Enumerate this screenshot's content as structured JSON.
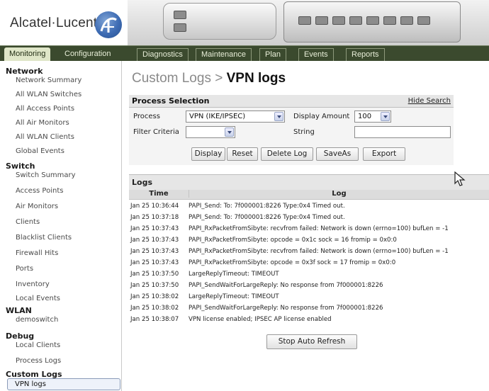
{
  "brand": {
    "name": "Alcatel·Lucent"
  },
  "nav": {
    "tabs": [
      "Monitoring",
      "Configuration",
      "Diagnostics",
      "Maintenance",
      "Plan",
      "Events",
      "Reports"
    ],
    "active": "Monitoring"
  },
  "sidebar": {
    "groups": [
      {
        "title": "Network",
        "items": [
          "Network Summary",
          "All WLAN Switches",
          "All Access Points",
          "All Air Monitors",
          "All WLAN Clients",
          "Global Events"
        ]
      },
      {
        "title": "Switch",
        "items": [
          "Switch Summary",
          "Access Points",
          "Air Monitors",
          "Clients",
          "Blacklist Clients",
          "Firewall Hits",
          "Ports",
          "Inventory",
          "Local Events"
        ]
      },
      {
        "title": "WLAN",
        "items": [
          "demoswitch"
        ]
      },
      {
        "title": "Debug",
        "items": [
          "Local Clients",
          "Process Logs"
        ]
      },
      {
        "title": "Custom Logs",
        "items": [
          "VPN logs"
        ]
      }
    ],
    "selected": "VPN logs"
  },
  "page": {
    "title_prefix": "Custom Logs >",
    "title_main": "VPN logs"
  },
  "process_selection": {
    "title": "Process Selection",
    "hide_link": "Hide Search",
    "process_label": "Process",
    "process_value": "VPN (IKE/IPSEC)",
    "display_amount_label": "Display Amount",
    "display_amount_value": "100",
    "filter_label": "Filter Criteria",
    "filter_value": "",
    "string_label": "String",
    "string_value": "",
    "buttons": {
      "display": "Display",
      "reset": "Reset",
      "delete": "Delete Log",
      "saveas": "SaveAs",
      "export": "Export"
    }
  },
  "logs": {
    "title": "Logs",
    "col_time": "Time",
    "col_log": "Log",
    "rows": [
      {
        "time": "Jan 25 10:36:44",
        "log": "PAPI_Send: To: 7f000001:8226 Type:0x4 Timed out."
      },
      {
        "time": "Jan 25 10:37:18",
        "log": "PAPI_Send: To: 7f000001:8226 Type:0x4 Timed out."
      },
      {
        "time": "Jan 25 10:37:43",
        "log": "PAPI_RxPacketFromSibyte: recvfrom failed: Network is down (errno=100) bufLen = -1"
      },
      {
        "time": "Jan 25 10:37:43",
        "log": "PAPI_RxPacketFromSibyte: opcode = 0x1c sock = 16 fromip = 0x0:0"
      },
      {
        "time": "Jan 25 10:37:43",
        "log": "PAPI_RxPacketFromSibyte: recvfrom failed: Network is down (errno=100) bufLen = -1"
      },
      {
        "time": "Jan 25 10:37:43",
        "log": "PAPI_RxPacketFromSibyte: opcode = 0x3f sock = 17 fromip = 0x0:0"
      },
      {
        "time": "Jan 25 10:37:50",
        "log": "LargeReplyTimeout: TIMEOUT"
      },
      {
        "time": "Jan 25 10:37:50",
        "log": "PAPI_SendWaitForLargeReply: No response from 7f000001:8226"
      },
      {
        "time": "Jan 25 10:38:02",
        "log": "LargeReplyTimeout: TIMEOUT"
      },
      {
        "time": "Jan 25 10:38:02",
        "log": "PAPI_SendWaitForLargeReply: No response from 7f000001:8226"
      },
      {
        "time": "Jan 25 10:38:07",
        "log": "VPN license enabled; IPSEC AP license enabled"
      }
    ],
    "stop_button": "Stop Auto Refresh"
  }
}
